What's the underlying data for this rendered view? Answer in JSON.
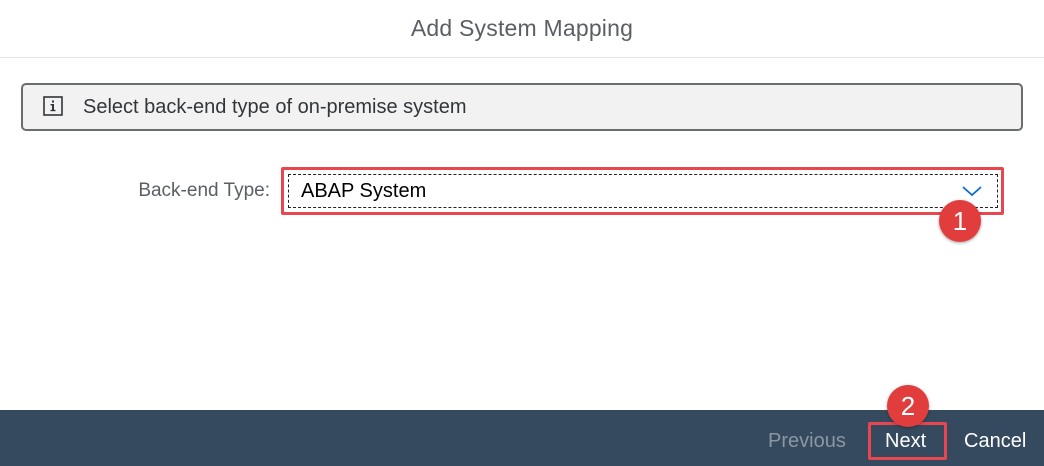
{
  "dialog": {
    "title": "Add System Mapping"
  },
  "info": {
    "icon": "info-icon",
    "message": "Select back-end type of on-premise system"
  },
  "form": {
    "backend_type_label": "Back-end Type:",
    "backend_type_value": "ABAP System",
    "dropdown_icon": "chevron-down-icon"
  },
  "annotations": {
    "step1": "1",
    "step2": "2",
    "highlight_color": "#e8474f",
    "badge_color": "#e23d3d"
  },
  "footer": {
    "previous_label": "Previous",
    "next_label": "Next",
    "cancel_label": "Cancel",
    "background_color": "#354a5f"
  }
}
